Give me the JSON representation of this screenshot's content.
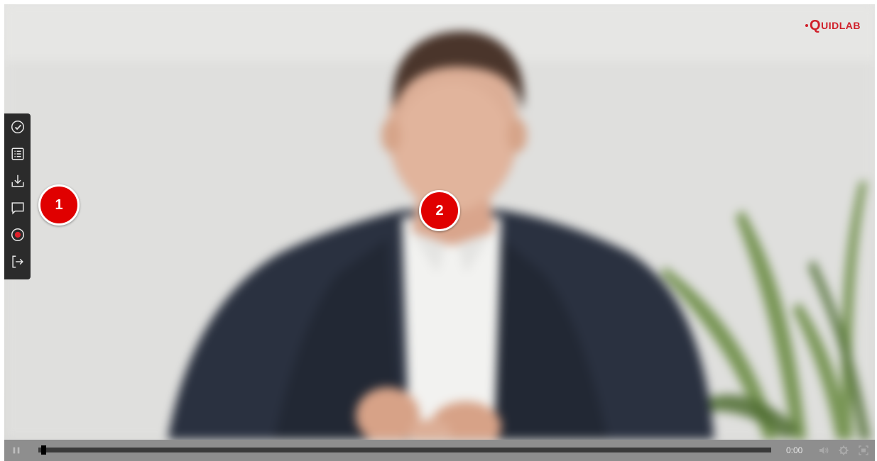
{
  "player": {
    "logo": {
      "prefix_letter": "Q",
      "rest": "UIDLAB"
    },
    "sidebar_tools": [
      {
        "name": "check-circle-icon"
      },
      {
        "name": "list-icon"
      },
      {
        "name": "download-icon"
      },
      {
        "name": "comment-icon"
      },
      {
        "name": "record-icon"
      },
      {
        "name": "exit-icon"
      }
    ],
    "annotations": [
      {
        "label": "1"
      },
      {
        "label": "2"
      }
    ],
    "controls": {
      "time": "0:00",
      "progress": 0.0
    }
  },
  "colors": {
    "accent": "#d0202a",
    "badge": "#e00000",
    "toolbar": "#2b2b2b",
    "controls_bar": "#8e8e8e"
  }
}
